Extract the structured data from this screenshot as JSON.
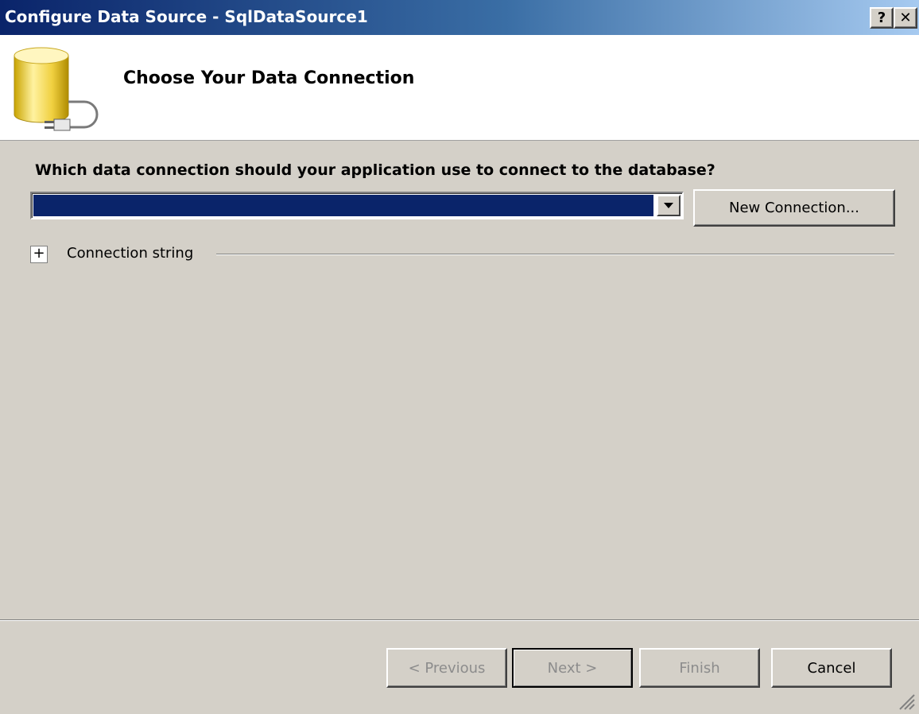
{
  "window": {
    "title": "Configure Data Source - SqlDataSource1",
    "help_label": "?",
    "close_label": "✕"
  },
  "header": {
    "title": "Choose Your Data Connection"
  },
  "body": {
    "question": "Which data connection should your application use to connect to the database?",
    "connection_combo": {
      "selected_value": ""
    },
    "new_connection_label": "New Connection...",
    "connection_string": {
      "expander_symbol": "+",
      "label": "Connection string"
    }
  },
  "footer": {
    "previous_label": "< Previous",
    "next_label": "Next >",
    "finish_label": "Finish",
    "cancel_label": "Cancel"
  },
  "colors": {
    "selection_highlight": "#0a246a",
    "dialog_background": "#d4d0c8",
    "header_background": "#ffffff",
    "disabled_text": "#8c8c8c"
  },
  "icons": [
    "database-plug-icon",
    "dropdown-arrow-icon",
    "expand-plus-icon",
    "resize-grip-icon"
  ]
}
